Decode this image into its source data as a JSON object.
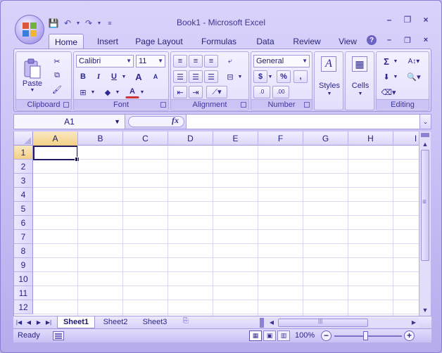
{
  "window": {
    "title": "Book1 - Microsoft Excel"
  },
  "qat": {
    "save_icon": "save-icon",
    "undo_icon": "undo-icon",
    "redo_icon": "redo-icon",
    "customize_icon": "customize-icon"
  },
  "window_controls": {
    "minimize": "–",
    "restore": "❐",
    "close": "×"
  },
  "ribbon_tabs": [
    "Home",
    "Insert",
    "Page Layout",
    "Formulas",
    "Data",
    "Review",
    "View"
  ],
  "ribbon_controls": {
    "help": "?",
    "minimize": "–",
    "restore": "❐",
    "close": "×"
  },
  "groups": {
    "clipboard": {
      "label": "Clipboard",
      "paste": "Paste"
    },
    "font": {
      "label": "Font",
      "font_name": "Calibri",
      "font_size": "11",
      "bold": "B",
      "italic": "I",
      "underline": "U",
      "grow": "A",
      "shrink": "A",
      "font_color": "A"
    },
    "alignment": {
      "label": "Alignment"
    },
    "number": {
      "label": "Number",
      "format": "General",
      "currency": "$",
      "percent": "%",
      "comma": ",",
      "inc_decimal": ".0",
      "dec_decimal": ".00"
    },
    "styles": {
      "label": "Styles"
    },
    "cells": {
      "label": "Cells"
    },
    "editing": {
      "label": "Editing",
      "sum": "Σ"
    }
  },
  "formula_bar": {
    "name_box": "A1",
    "fx": "fx",
    "formula": ""
  },
  "grid": {
    "columns": [
      "A",
      "B",
      "C",
      "D",
      "E",
      "F",
      "G",
      "H",
      "I"
    ],
    "rows": [
      "1",
      "2",
      "3",
      "4",
      "5",
      "6",
      "7",
      "8",
      "9",
      "10",
      "11",
      "12"
    ],
    "active_cell": "A1"
  },
  "sheets": {
    "tabs": [
      "Sheet1",
      "Sheet2",
      "Sheet3"
    ],
    "active": "Sheet1"
  },
  "status": {
    "text": "Ready",
    "zoom": "100%",
    "zoom_percent": 100
  },
  "colors": {
    "accent": "#6d62c6",
    "selection_header": "#f3cf84",
    "active_cell_border": "#1e1a66"
  }
}
